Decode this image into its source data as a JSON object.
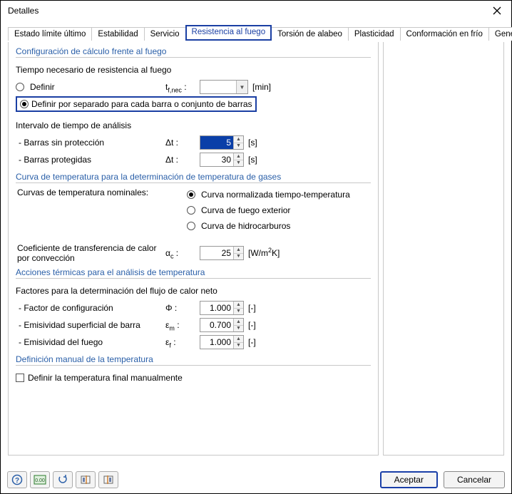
{
  "window": {
    "title": "Detalles"
  },
  "tabs": [
    {
      "label": "Estado límite último"
    },
    {
      "label": "Estabilidad"
    },
    {
      "label": "Servicio"
    },
    {
      "label": "Resistencia al fuego",
      "active": true
    },
    {
      "label": "Torsión de alabeo"
    },
    {
      "label": "Plasticidad"
    },
    {
      "label": "Conformación en frío"
    },
    {
      "label": "General"
    }
  ],
  "section1": {
    "title": "Configuración de cálculo frente al fuego",
    "req_time_label": "Tiempo necesario de resistencia al fuego",
    "radio_define": "Definir",
    "tfnec_sym": "t f,nec :",
    "tfnec_unit": "[min]",
    "radio_separado": "Definir por separado para cada barra o conjunto de barras",
    "interval_label": "Intervalo de tiempo de análisis",
    "row_unprot": "- Barras sin protección",
    "row_prot": "- Barras protegidas",
    "dt_sym": "Δt :",
    "dt_unprot_val": "5",
    "dt_prot_val": "30",
    "dt_unit": "[s]"
  },
  "section2": {
    "title": "Curva de temperatura para la determinación de temperatura de gases",
    "nom_label": "Curvas de temperatura nominales:",
    "r1": "Curva normalizada tiempo-temperatura",
    "r2": "Curva de fuego exterior",
    "r3": "Curva de hidrocarburos",
    "coef_label": "Coeficiente de transferencia de calor por convección",
    "alpha_sym": "αc :",
    "alpha_val": "25",
    "alpha_unit_html": "[W/m²K]"
  },
  "section3": {
    "title": "Acciones términas para el análisis de temperatura",
    "title_fixed": "Acciones térmicas para el análisis de temperatura",
    "factors_label": "Factores para la determinación del flujo de calor neto",
    "r_conf": "- Factor de configuración",
    "r_emis_bar": "- Emisividad superficial de barra",
    "r_emis_fire": "- Emisividad del fuego",
    "phi_sym": "Φ :",
    "em_sym": "εm :",
    "ef_sym": "εf :",
    "phi_val": "1.000",
    "em_val": "0.700",
    "ef_val": "1.000",
    "unit_dash": "[-]"
  },
  "section4": {
    "title": "Definición manual de la temperatura",
    "cb_label": "Definir la temperatura final manualmente"
  },
  "footer": {
    "ok": "Aceptar",
    "cancel": "Cancelar"
  }
}
